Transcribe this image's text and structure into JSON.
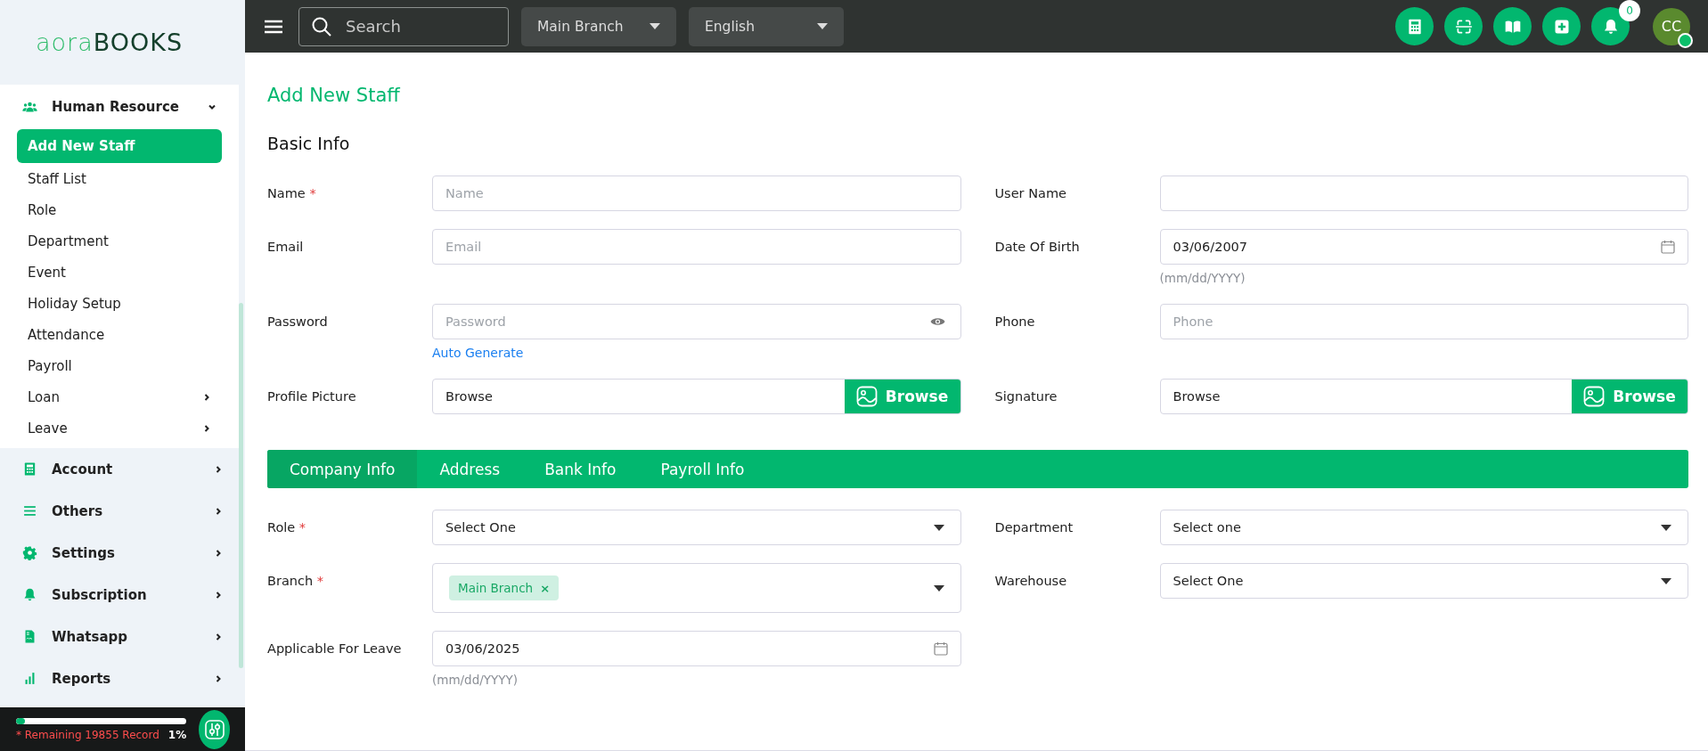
{
  "logo": {
    "part_1": "aora",
    "part_2": "BOOKS"
  },
  "topbar": {
    "search": {
      "placeholder": "Search"
    },
    "dropdowns": [
      {
        "value": "Main Branch"
      },
      {
        "value": "English"
      }
    ],
    "actions": [
      {
        "kind": "calculator"
      },
      {
        "kind": "scan"
      },
      {
        "kind": "book"
      },
      {
        "kind": "add"
      },
      {
        "kind": "bell",
        "badge": "0"
      }
    ],
    "avatar": {
      "initials": "CC",
      "online": true
    }
  },
  "sidebar": {
    "items": [
      {
        "label": "Human Resource",
        "kind": "users",
        "expanded": true,
        "children": [
          {
            "label": "Add New Staff",
            "selected": true,
            "has_submenu": false
          },
          {
            "label": "Staff List",
            "selected": false,
            "has_submenu": false
          },
          {
            "label": "Role",
            "selected": false,
            "has_submenu": false
          },
          {
            "label": "Department",
            "selected": false,
            "has_submenu": false
          },
          {
            "label": "Event",
            "selected": false,
            "has_submenu": false
          },
          {
            "label": "Holiday Setup",
            "selected": false,
            "has_submenu": false
          },
          {
            "label": "Attendance",
            "selected": false,
            "has_submenu": false
          },
          {
            "label": "Payroll",
            "selected": false,
            "has_submenu": false
          },
          {
            "label": "Loan",
            "selected": false,
            "has_submenu": true
          },
          {
            "label": "Leave",
            "selected": false,
            "has_submenu": true
          }
        ]
      },
      {
        "label": "Account",
        "kind": "calculator",
        "expanded": false
      },
      {
        "label": "Others",
        "kind": "list",
        "expanded": false
      },
      {
        "label": "Settings",
        "kind": "gear",
        "expanded": false
      },
      {
        "label": "Subscription",
        "kind": "bell",
        "expanded": false
      },
      {
        "label": "Whatsapp",
        "kind": "file",
        "expanded": false
      },
      {
        "label": "Reports",
        "kind": "chart",
        "expanded": false
      }
    ]
  },
  "usage": {
    "level": 0.05,
    "text": "* Remaining 19855 Record",
    "percent": "1%"
  },
  "page": {
    "title": "Add New Staff",
    "section": "Basic Info",
    "basic_rows": [
      [
        {
          "label": "Name",
          "required_mark": "*",
          "kind": "text",
          "placeholder": "Name"
        },
        {
          "label": "User Name",
          "kind": "text"
        }
      ],
      [
        {
          "label": "Email",
          "kind": "text",
          "placeholder": "Email"
        },
        {
          "label": "Date Of Birth",
          "kind": "date",
          "value": "03/06/2007",
          "hint": "(mm/dd/YYYY)"
        }
      ],
      [
        {
          "label": "Password",
          "kind": "password",
          "placeholder": "Password",
          "link": "Auto Generate"
        },
        {
          "label": "Phone",
          "kind": "text",
          "placeholder": "Phone"
        }
      ],
      [
        {
          "label": "Profile Picture",
          "kind": "file",
          "value": "Browse",
          "button": "Browse"
        },
        {
          "label": "Signature",
          "kind": "file",
          "value": "Browse",
          "button": "Browse"
        }
      ]
    ],
    "tabs": [
      {
        "label": "Company Info",
        "selected": true
      },
      {
        "label": "Address",
        "selected": false
      },
      {
        "label": "Bank Info",
        "selected": false
      },
      {
        "label": "Payroll Info",
        "selected": false
      }
    ],
    "company_rows": [
      [
        {
          "label": "Role",
          "required_mark": "*",
          "kind": "select",
          "value": "Select One"
        },
        {
          "label": "Department",
          "kind": "select",
          "value": "Select one"
        }
      ],
      [
        {
          "label": "Branch",
          "required_mark": "*",
          "kind": "tags",
          "tags": [
            {
              "text": "Main Branch",
              "remove": "×"
            }
          ]
        },
        {
          "label": "Warehouse",
          "kind": "select",
          "value": "Select One"
        }
      ],
      [
        {
          "label": "Applicable For Leave",
          "kind": "date",
          "value": "03/06/2025",
          "hint": "(mm/dd/YYYY)"
        }
      ]
    ]
  }
}
